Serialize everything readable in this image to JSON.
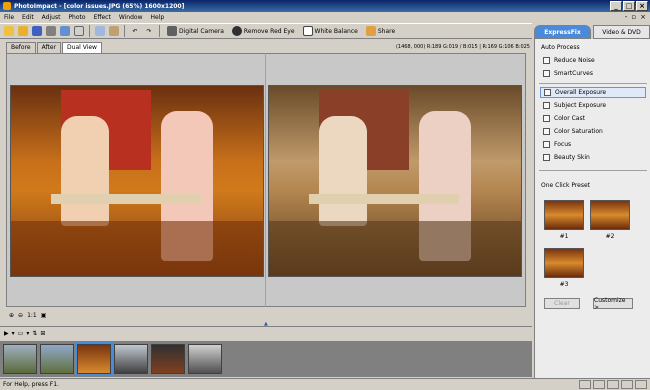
{
  "window": {
    "title": "PhotoImpact - [color issues.JPG (65%) 1600x1200]"
  },
  "menu": [
    "File",
    "Edit",
    "Adjust",
    "Photo",
    "Effect",
    "Window",
    "Help"
  ],
  "toolbar": {
    "digital_camera": "Digital Camera",
    "remove_red_eye": "Remove Red Eye",
    "white_balance": "White Balance",
    "share": "Share"
  },
  "right_tabs": {
    "expressfix": "ExpressFix",
    "video_dvd": "Video & DVD"
  },
  "view_tabs": {
    "before": "Before",
    "after": "After",
    "dual": "Dual View"
  },
  "coords": "(1468, 000) R:189 G:019 / B:015 | R:169 G:106 B:025",
  "zoom": {
    "ratio": "1:1"
  },
  "status": "For Help, press F1.",
  "panel": {
    "auto_process_title": "Auto Process",
    "auto_items": [
      "Reduce Noise",
      "SmartCurves"
    ],
    "fix_items": [
      "Overall Exposure",
      "Subject Exposure",
      "Color Cast",
      "Color Saturation",
      "Focus",
      "Beauty Skin"
    ],
    "one_click_title": "One Click Preset",
    "presets": [
      "#1",
      "#2",
      "#3"
    ],
    "clear_label": "Clear",
    "customize_label": "Customize >"
  },
  "colors": {
    "accent": "#4a8ad9",
    "title_bar": "#0a246a"
  }
}
